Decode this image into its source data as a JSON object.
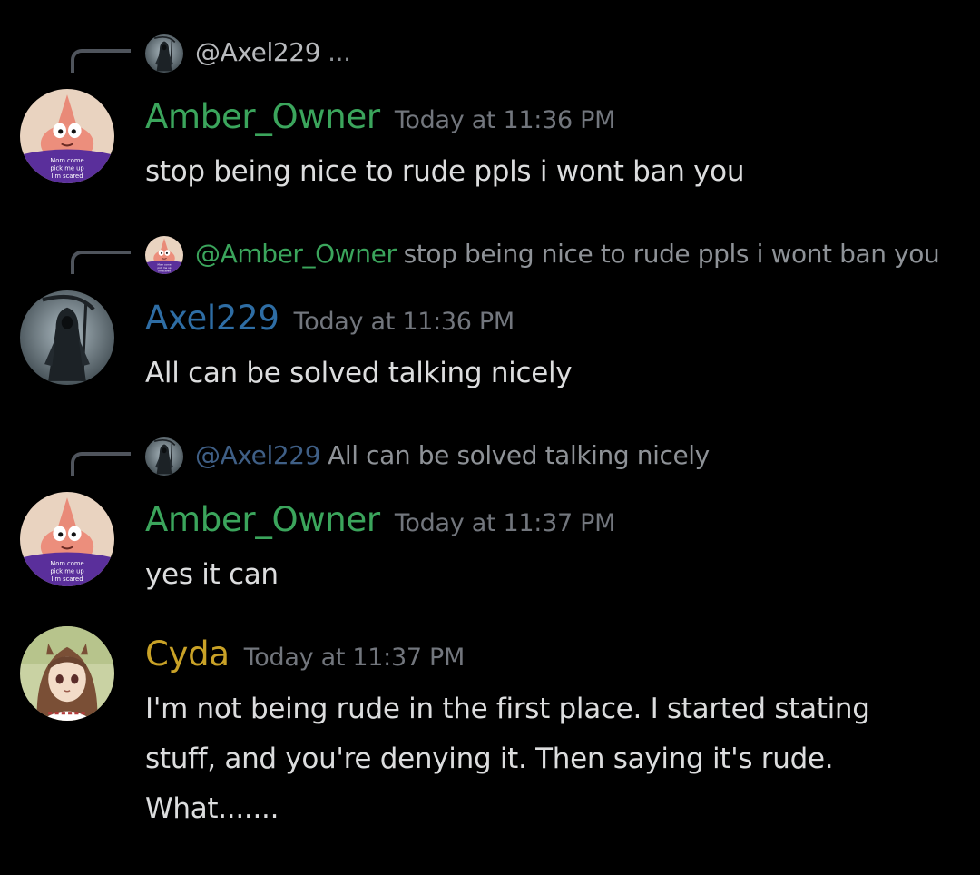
{
  "colors": {
    "background": "#000000",
    "amber_owner": "#3ba55c",
    "axel229": "#2e6da4",
    "cyda": "#c9a227",
    "mention": "#3f5f86",
    "timestamp": "#72767d",
    "body_text": "#dcddde",
    "reply_text": "#8e9297",
    "reply_spine": "#4f545c"
  },
  "messages": [
    {
      "reply": {
        "avatar_icon": "reaper-avatar-icon",
        "name": "@Axel229",
        "text": "",
        "more": "..."
      },
      "avatar_icon": "starfish-avatar-icon",
      "username": "Amber_Owner",
      "timestamp": "Today at 11:36 PM",
      "content": "stop being nice to rude ppls i wont ban you"
    },
    {
      "reply": {
        "avatar_icon": "starfish-avatar-icon",
        "name": "@Amber_Owner",
        "text": "stop being nice to rude ppls i wont ban you"
      },
      "avatar_icon": "reaper-avatar-icon",
      "username": "Axel229",
      "timestamp": "Today at 11:36 PM",
      "content": "All can be solved talking nicely"
    },
    {
      "reply": {
        "avatar_icon": "reaper-avatar-icon",
        "name": "@Axel229",
        "text": "All can be solved talking nicely"
      },
      "avatar_icon": "starfish-avatar-icon",
      "username": "Amber_Owner",
      "timestamp": "Today at 11:37 PM",
      "content": "yes it can"
    },
    {
      "avatar_icon": "anime-girl-avatar-icon",
      "username": "Cyda",
      "timestamp": "Today at 11:37 PM",
      "content_lines": [
        "I'm not being rude in the first place. I started stating",
        "stuff, and you're denying it. Then saying it's rude.",
        "What......."
      ]
    }
  ],
  "avatar_shirt_text": [
    "Mom come",
    "pick me up",
    "I'm scared"
  ]
}
